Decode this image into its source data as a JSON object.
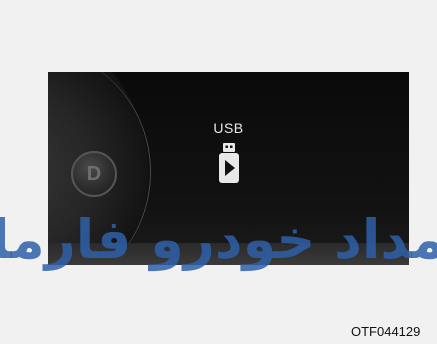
{
  "screen": {
    "source_label": "USB",
    "drive_indicator": "D",
    "icon": "usb-drive-play-icon"
  },
  "watermark": {
    "text": "مداد خودرو فارما",
    "color": "#2f5fa8"
  },
  "figure_code": "OTF044129"
}
